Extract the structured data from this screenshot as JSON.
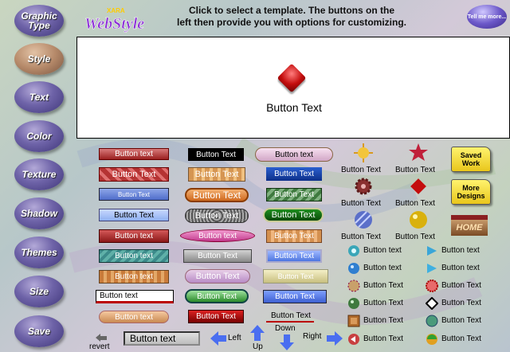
{
  "header": {
    "line1": "Click to select a template. The buttons on the",
    "line2": "left then provide you with options for customizing."
  },
  "logo": {
    "brand": "XARA",
    "name": "WebStyle"
  },
  "tell_me": "Tell me more...",
  "nav": [
    {
      "label": "Graphic Type"
    },
    {
      "label": "Style"
    },
    {
      "label": "Text"
    },
    {
      "label": "Color"
    },
    {
      "label": "Texture"
    },
    {
      "label": "Shadow"
    },
    {
      "label": "Themes"
    },
    {
      "label": "Size"
    },
    {
      "label": "Save"
    }
  ],
  "preview": {
    "text": "Button Text"
  },
  "templates": {
    "col1": [
      "Button text",
      "Button Text",
      "Button Text",
      "Button Text",
      "Button text",
      "Button text",
      "Button text",
      "Button text",
      "Button text"
    ],
    "col2": [
      "Button Text",
      "Button Text",
      "Button Text",
      "Button Text",
      "Button text",
      "Button Text",
      "Button Text",
      "Button Text",
      "Button Text"
    ],
    "col3": [
      "Button text",
      "Button Text",
      "Button Text",
      "Button Text",
      "Button Text",
      "Button Text",
      "Button Text",
      "Button Text",
      "Button Text",
      "Button Text"
    ],
    "icons_grid": [
      "Button Text",
      "Button Text",
      "Button Text",
      "Button Text",
      "Button Text",
      "Button Text"
    ],
    "list_left": [
      "Button text",
      "Button text",
      "Button Text",
      "Button Text",
      "Button Text",
      "Button Text"
    ],
    "list_right": [
      "Button text",
      "Button text",
      "Button Text",
      "Button Text",
      "Button Text",
      "Button Text"
    ],
    "home": "HOME"
  },
  "folders": {
    "saved": "Saved Work",
    "more": "More Designs"
  },
  "bottom": {
    "revert": "revert",
    "text_field": "Button text",
    "left": "Left",
    "up": "Up",
    "down": "Down",
    "right": "Right"
  },
  "colors": {
    "accent": "#6e63a8",
    "active": "#b68a6a"
  }
}
